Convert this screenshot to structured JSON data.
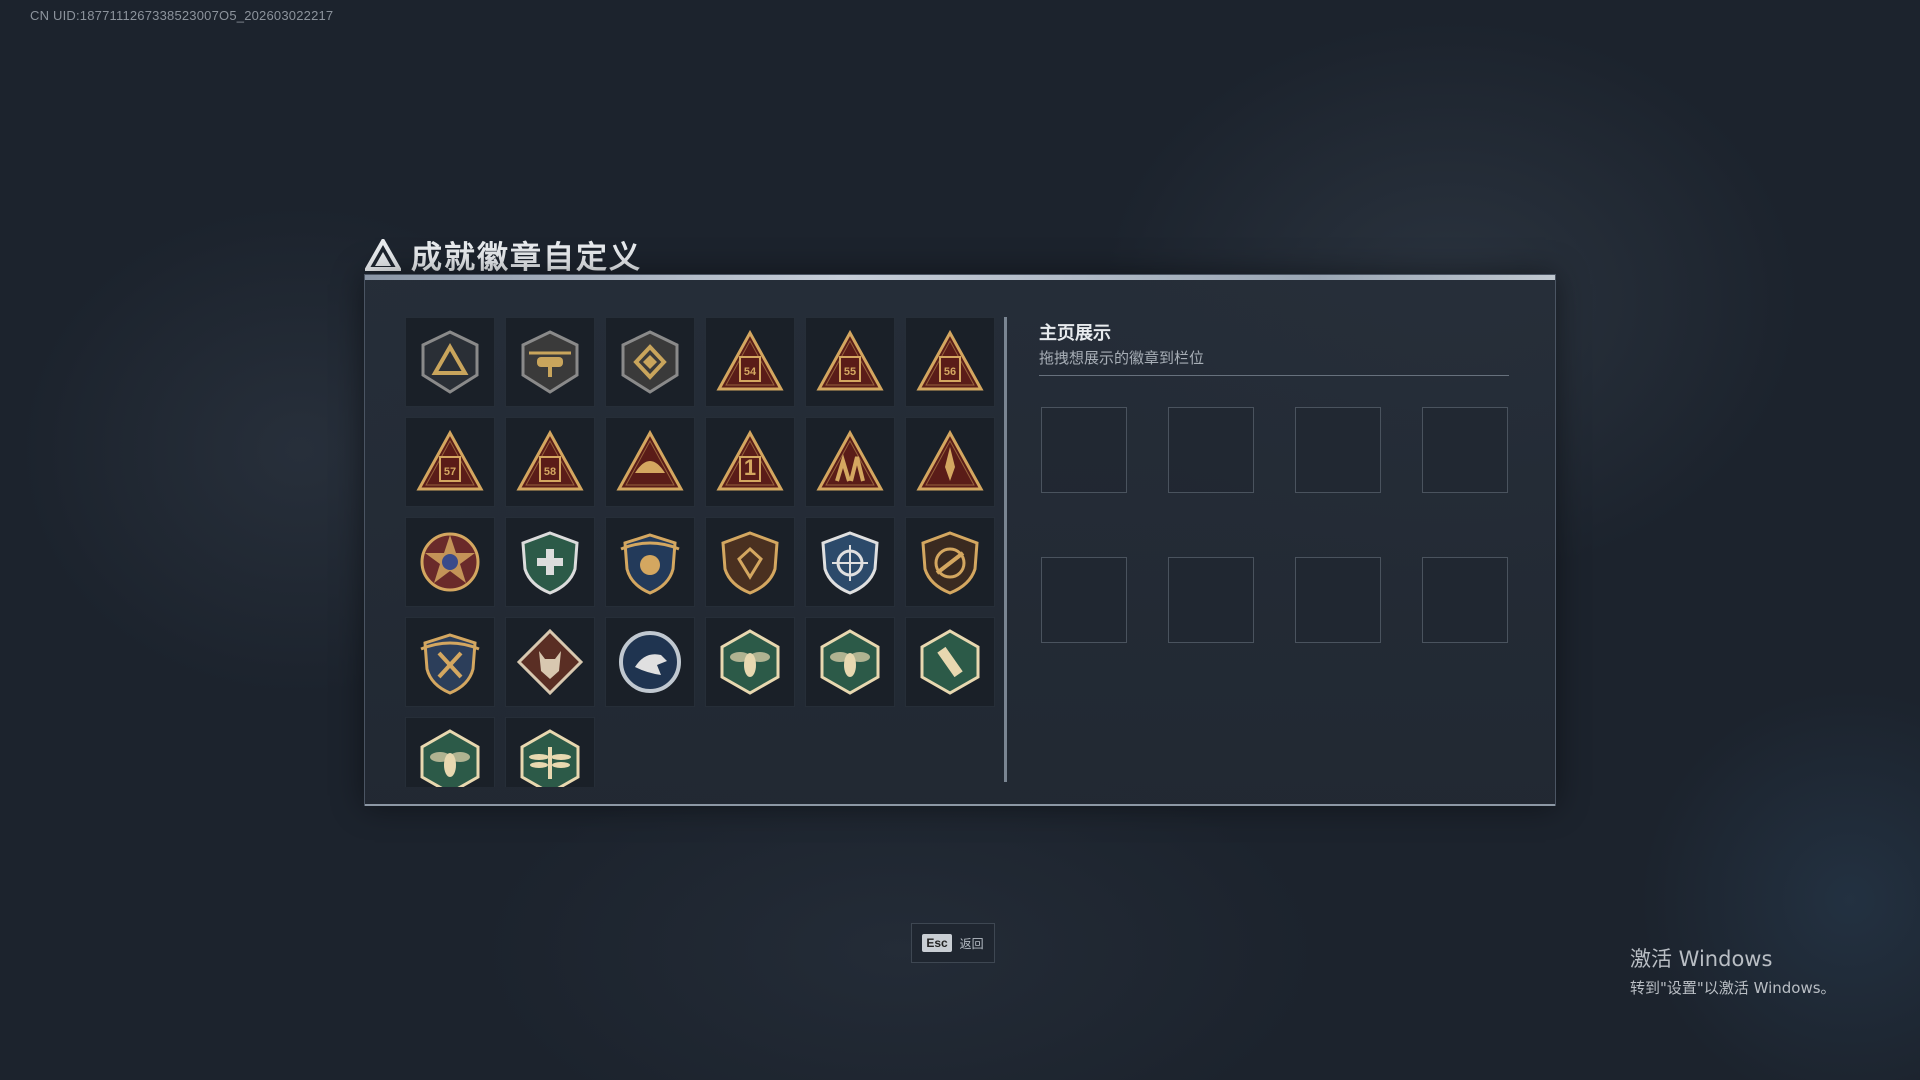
{
  "uid_text": "CN UID:1877111267338523007O5_202603022217",
  "window": {
    "title": "成就徽章自定义"
  },
  "colors": {
    "gold": "#c9a55c",
    "dark_red": "#5a1c18",
    "green": "#2c5a48",
    "navy": "#233a5a",
    "bronze": "#3a2a20"
  },
  "badges": [
    {
      "name": "triangle-emblem-shield",
      "shape": "hex-shield",
      "bg": "#2a2f36",
      "fg": "#c9a55c",
      "symbol": "triangle"
    },
    {
      "name": "helicopter-shield",
      "shape": "hex-shield",
      "bg": "#3a3a3a",
      "fg": "#c9a55c",
      "symbol": "heli"
    },
    {
      "name": "diamond-shield",
      "shape": "hex-shield",
      "bg": "#3a3a3a",
      "fg": "#c9a55c",
      "symbol": "diamond"
    },
    {
      "name": "triangle-badge-54",
      "shape": "triangle",
      "bg": "#5a1c18",
      "fg": "#d4a760",
      "text": "54"
    },
    {
      "name": "triangle-badge-55",
      "shape": "triangle",
      "bg": "#5a1c18",
      "fg": "#d4a760",
      "text": "55"
    },
    {
      "name": "triangle-badge-56",
      "shape": "triangle",
      "bg": "#5a1c18",
      "fg": "#d4a760",
      "text": "56"
    },
    {
      "name": "triangle-badge-57",
      "shape": "triangle",
      "bg": "#5a1c18",
      "fg": "#d4a760",
      "text": "57"
    },
    {
      "name": "triangle-badge-58",
      "shape": "triangle",
      "bg": "#5a1c18",
      "fg": "#d4a760",
      "text": "58"
    },
    {
      "name": "triangle-badge-helmet",
      "shape": "triangle",
      "bg": "#5a1c18",
      "fg": "#d4a760",
      "symbol": "helmet"
    },
    {
      "name": "triangle-badge-1",
      "shape": "triangle",
      "bg": "#5a1c18",
      "fg": "#d4a760",
      "text": "1"
    },
    {
      "name": "triangle-badge-soldiers",
      "shape": "triangle",
      "bg": "#5a1c18",
      "fg": "#d4a760",
      "symbol": "figures"
    },
    {
      "name": "triangle-badge-rocket",
      "shape": "triangle",
      "bg": "#5a1c18",
      "fg": "#d4a760",
      "symbol": "rocket"
    },
    {
      "name": "star-medal",
      "shape": "star-circle",
      "bg": "#6a2a2a",
      "fg": "#d4a760",
      "symbol": "star"
    },
    {
      "name": "green-shield-medal",
      "shape": "shield",
      "bg": "#2c5a48",
      "fg": "#dcdcdc",
      "symbol": "cross"
    },
    {
      "name": "crest-medal",
      "shape": "crest",
      "bg": "#233a5a",
      "fg": "#d4a760",
      "symbol": "crest"
    },
    {
      "name": "gem-shield",
      "shape": "shield",
      "bg": "#4a3020",
      "fg": "#d4a760",
      "symbol": "gem"
    },
    {
      "name": "crosshair-shield",
      "shape": "shield",
      "bg": "#2c4a6a",
      "fg": "#e0e0e0",
      "symbol": "crosshair"
    },
    {
      "name": "no-rifle-shield",
      "shape": "shield",
      "bg": "#3a2a20",
      "fg": "#d4a760",
      "symbol": "rifle"
    },
    {
      "name": "gold-crest-shield",
      "shape": "crest",
      "bg": "#2c3e5a",
      "fg": "#d4a760",
      "symbol": "swords"
    },
    {
      "name": "wolf-diamond",
      "shape": "diamond",
      "bg": "#5a2e24",
      "fg": "#d8c8b0",
      "symbol": "wolf"
    },
    {
      "name": "eagle-coin",
      "shape": "circle",
      "bg": "#1f3450",
      "fg": "#e0e0e0",
      "symbol": "eagle"
    },
    {
      "name": "wasp-hexagon-1",
      "shape": "hexagon",
      "bg": "#2c5a48",
      "fg": "#e8d8b0",
      "symbol": "wasp"
    },
    {
      "name": "wasp-hexagon-2",
      "shape": "hexagon",
      "bg": "#2c5a48",
      "fg": "#e8d8b0",
      "symbol": "wasp"
    },
    {
      "name": "tool-hexagon",
      "shape": "hexagon",
      "bg": "#2c5a48",
      "fg": "#e8d8b0",
      "symbol": "tool"
    },
    {
      "name": "mosquito-hexagon",
      "shape": "hexagon",
      "bg": "#2c5a48",
      "fg": "#e8d8b0",
      "symbol": "wasp"
    },
    {
      "name": "dragonfly-hexagon",
      "shape": "hexagon",
      "bg": "#2c5a48",
      "fg": "#e8d8b0",
      "symbol": "dragonfly"
    }
  ],
  "showcase": {
    "title": "主页展示",
    "subtitle": "拖拽想展示的徽章到栏位",
    "slot_count": 8
  },
  "footer": {
    "esc_key": "Esc",
    "esc_label": "返回"
  },
  "windows_activation": {
    "title": "激活 Windows",
    "subtitle": "转到\"设置\"以激活 Windows。"
  }
}
